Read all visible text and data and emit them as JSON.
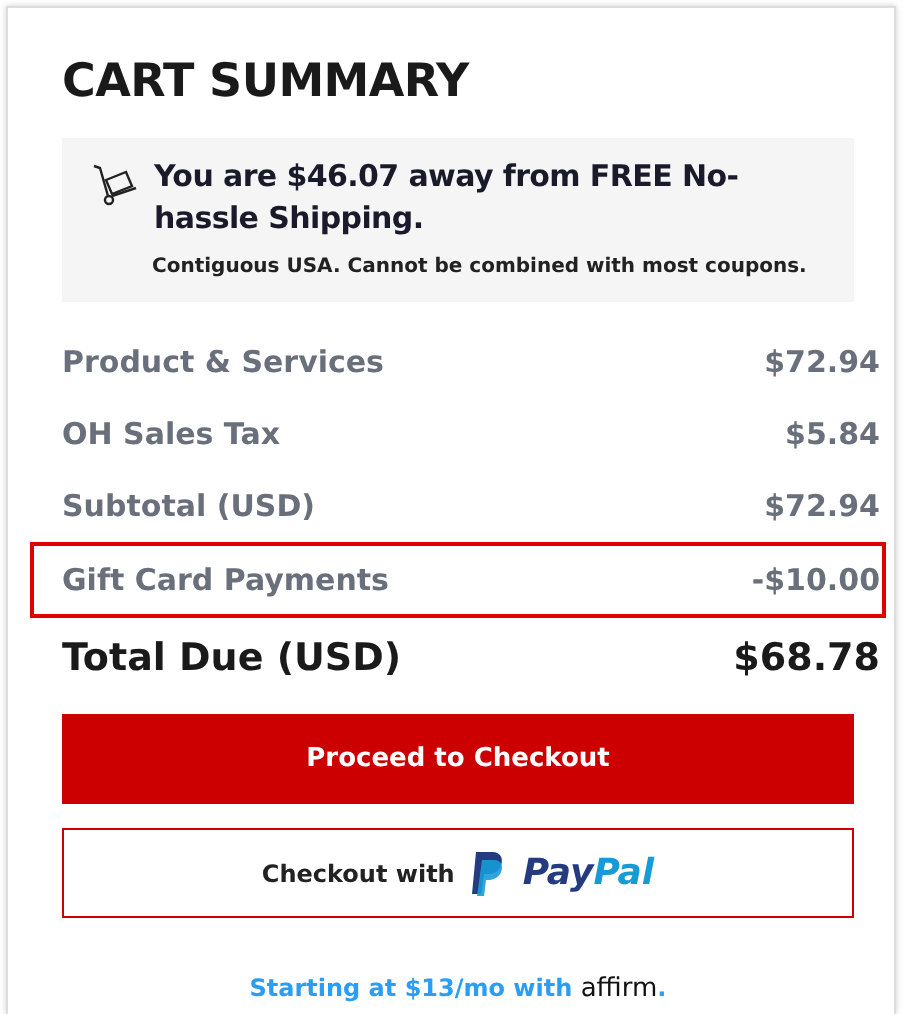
{
  "title": "CART SUMMARY",
  "shipping_notice": {
    "message": "You are $46.07 away from FREE No-hassle Shipping.",
    "note": "Contiguous USA. Cannot be combined with most coupons."
  },
  "lines": [
    {
      "label": "Product & Services",
      "amount": "$72.94",
      "highlighted": false
    },
    {
      "label": "OH Sales Tax",
      "amount": "$5.84",
      "highlighted": false
    },
    {
      "label": "Subtotal (USD)",
      "amount": "$72.94",
      "highlighted": false
    },
    {
      "label": "Gift Card Payments",
      "amount": "-$10.00",
      "highlighted": true
    }
  ],
  "total": {
    "label": "Total Due (USD)",
    "amount": "$68.78"
  },
  "checkout_button": "Proceed to Checkout",
  "paypal_button": {
    "label": "Checkout with",
    "logo_parts": [
      "Pay",
      "Pal"
    ]
  },
  "financing": {
    "text": "Starting at $13/mo with",
    "logo": "affirm",
    "suffix": "."
  }
}
